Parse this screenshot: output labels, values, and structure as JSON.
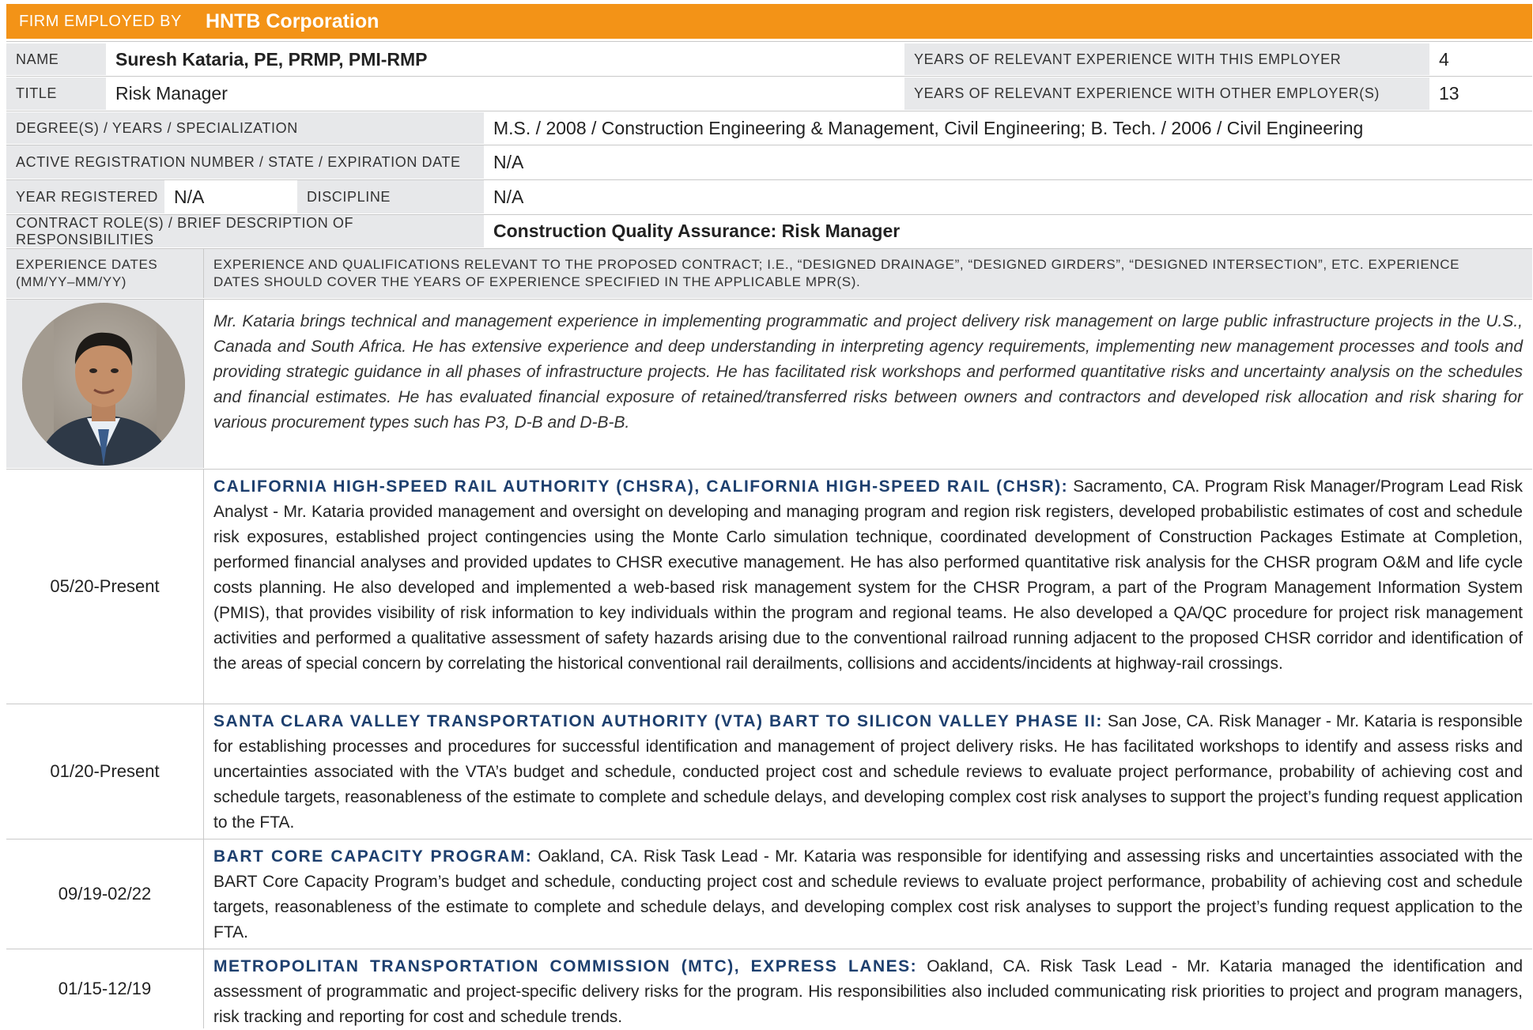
{
  "header": {
    "firm_label": "FIRM EMPLOYED BY",
    "firm_value": "HNTB Corporation"
  },
  "name_row": {
    "label": "NAME",
    "value": "Suresh Kataria, PE, PRMP, PMI-RMP",
    "years_this_label": "YEARS OF RELEVANT EXPERIENCE WITH THIS EMPLOYER",
    "years_this_value": "4"
  },
  "title_row": {
    "label": "TITLE",
    "value": "Risk Manager",
    "years_other_label": "YEARS OF RELEVANT EXPERIENCE WITH OTHER EMPLOYER(S)",
    "years_other_value": "13"
  },
  "degree_row": {
    "label": "DEGREE(S) / YEARS / SPECIALIZATION",
    "value": "M.S. / 2008 / Construction Engineering & Management, Civil Engineering; B. Tech. / 2006 / Civil Engineering"
  },
  "registration_row": {
    "label": "ACTIVE REGISTRATION NUMBER / STATE / EXPIRATION DATE",
    "value": "N/A"
  },
  "year_row": {
    "year_label": "YEAR REGISTERED",
    "year_value": "N/A",
    "discipline_label": "DISCIPLINE",
    "discipline_value": "N/A"
  },
  "contract_row": {
    "label": "CONTRACT ROLE(S) / BRIEF DESCRIPTION OF RESPONSIBILITIES",
    "value": "Construction Quality Assurance: Risk Manager"
  },
  "experience_header": {
    "dates_label_line1": "EXPERIENCE DATES",
    "dates_label_line2": "(MM/YY–MM/YY)",
    "desc_label": "EXPERIENCE AND QUALIFICATIONS RELEVANT TO THE PROPOSED CONTRACT; I.E., “DESIGNED DRAINAGE”, “DESIGNED GIRDERS”, “DESIGNED INTERSECTION”, ETC.  EXPERIENCE DATES SHOULD COVER THE YEARS OF EXPERIENCE SPECIFIED IN THE APPLICABLE MPR(S)."
  },
  "bio": "Mr. Kataria brings technical and management experience in implementing programmatic and project delivery risk management on large public infrastructure projects in the U.S., Canada and South Africa. He has extensive experience and deep understanding in interpreting agency requirements, implementing new management processes and tools and providing strategic guidance in all phases of infrastructure projects. He has facilitated risk workshops and performed quantitative risks and uncertainty analysis on the schedules and financial estimates. He has evaluated financial exposure of retained/transferred risks between owners and contractors and developed risk allocation and risk sharing for various procurement types such has P3, D-B and D-B-B.",
  "entries": [
    {
      "date": "05/20-Present",
      "project": "CALIFORNIA HIGH-SPEED RAIL AUTHORITY (CHSRA), CALIFORNIA HIGH-SPEED RAIL (CHSR):",
      "text": " Sacramento, CA. Program Risk Manager/Program Lead Risk Analyst - Mr. Kataria provided management and oversight on developing and managing program and region risk registers, developed probabilistic estimates of cost and schedule risk exposures, established project contingencies using the Monte Carlo simulation technique, coordinated development of Construction Packages Estimate at Completion, performed financial analyses and provided updates to CHSR executive management. He has also performed quantitative risk analysis for the CHSR program O&M and life cycle costs planning. He also developed and implemented a web-based risk management system for the CHSR Program, a part of the Program Management Information System (PMIS), that provides visibility of risk information to key individuals within the program and regional teams. He also developed a QA/QC procedure for project risk management activities and performed a qualitative assessment of safety hazards arising due to the conventional railroad running adjacent to the proposed CHSR corridor and identification of the areas of special concern by correlating the historical conventional rail derailments, collisions and accidents/incidents at highway-rail crossings."
    },
    {
      "date": "01/20-Present",
      "project": "SANTA CLARA VALLEY TRANSPORTATION AUTHORITY (VTA) BART TO SILICON VALLEY PHASE II:",
      "text": " San Jose, CA. Risk Manager - Mr. Kataria is responsible for establishing processes and procedures for successful identification and management of project delivery risks. He has facilitated workshops to identify and assess risks and uncertainties associated with the VTA’s budget and schedule, conducted project cost and schedule reviews to evaluate project performance, probability of achieving cost and schedule targets, reasonableness of the estimate to complete and schedule delays, and developing complex cost risk analyses to support the project’s funding request application to the FTA."
    },
    {
      "date": "09/19-02/22",
      "project": "BART CORE CAPACITY PROGRAM:",
      "text": " Oakland, CA. Risk Task Lead - Mr. Kataria was responsible for identifying and assessing risks and uncertainties associated with the BART Core Capacity Program’s budget and schedule, conducting project cost and schedule reviews to evaluate project performance, probability of achieving cost and schedule targets, reasonableness of the estimate to complete and schedule delays, and developing complex cost risk analyses to support the project’s funding request application to the FTA."
    },
    {
      "date": "01/15-12/19",
      "project": "METROPOLITAN TRANSPORTATION COMMISSION (MTC), EXPRESS LANES:",
      "text": " Oakland, CA. Risk Task Lead - Mr. Kataria managed the identification and assessment of programmatic and project-specific delivery risks for the program. His responsibilities also included communicating risk priorities to project and program managers, risk tracking and reporting for cost and schedule trends."
    }
  ]
}
